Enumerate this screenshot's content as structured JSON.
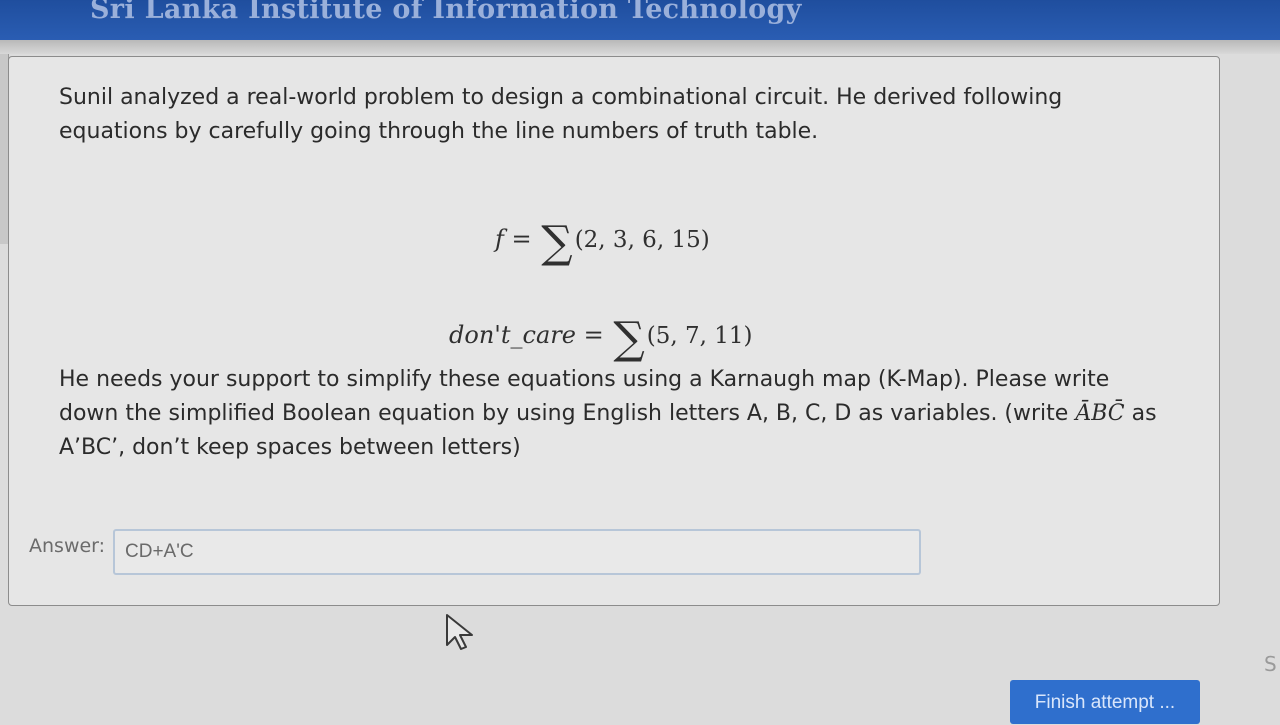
{
  "header": {
    "title": "Sri Lanka Institute of Information Technology"
  },
  "question": {
    "intro": "Sunil analyzed a real-world problem to design a combinational circuit. He derived following equations by carefully going through the line numbers of truth table.",
    "formula1_lhs": "f",
    "formula1_terms": "(2, 3, 6, 15)",
    "formula2_lhs": "don't_care",
    "formula2_terms": "(5, 7, 11)",
    "equals": "=",
    "sigma": "∑",
    "instruction_part1": "He needs your support to simplify these equations using a Karnaugh map (K-Map). Please write down the simplified Boolean equation by using English letters A, B, C, D as variables. (write ",
    "example_expression": "ĀBC̄",
    "instruction_part2": " as A’BC’, don’t keep spaces between letters)"
  },
  "answer": {
    "label": "Answer:",
    "value": "CD+A'C"
  },
  "footer": {
    "finish_label": "Finish attempt ...",
    "side_letter": "S"
  }
}
